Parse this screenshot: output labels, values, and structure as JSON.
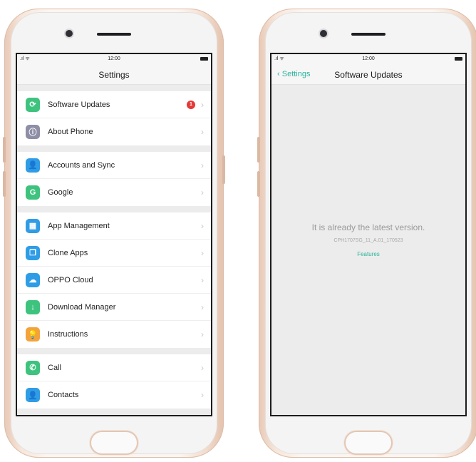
{
  "status_bar": {
    "signal": ".ıl ᯤ",
    "time": "12:00"
  },
  "left_screen": {
    "title": "Settings",
    "groups": [
      {
        "items": [
          {
            "label": "Software Updates",
            "icon": "refresh-icon",
            "glyph": "⟳",
            "color": "#3ec37f",
            "badge": "1"
          },
          {
            "label": "About Phone",
            "icon": "info-icon",
            "glyph": "ⓘ",
            "color": "#8e8ea6"
          }
        ]
      },
      {
        "items": [
          {
            "label": "Accounts and Sync",
            "icon": "person-icon",
            "glyph": "👤",
            "color": "#2f9ce6"
          },
          {
            "label": "Google",
            "icon": "google-icon",
            "glyph": "G",
            "color": "#3ec37f"
          }
        ]
      },
      {
        "items": [
          {
            "label": "App Management",
            "icon": "grid-icon",
            "glyph": "▦",
            "color": "#2f9ce6"
          },
          {
            "label": "Clone Apps",
            "icon": "clone-icon",
            "glyph": "❐",
            "color": "#2f9ce6"
          },
          {
            "label": "OPPO Cloud",
            "icon": "cloud-icon",
            "glyph": "☁",
            "color": "#2f9ce6"
          },
          {
            "label": "Download Manager",
            "icon": "download-icon",
            "glyph": "↓",
            "color": "#3ec37f"
          },
          {
            "label": "Instructions",
            "icon": "bulb-icon",
            "glyph": "💡",
            "color": "#f3a33a"
          }
        ]
      },
      {
        "items": [
          {
            "label": "Call",
            "icon": "phone-icon",
            "glyph": "✆",
            "color": "#3ec37f"
          },
          {
            "label": "Contacts",
            "icon": "contact-icon",
            "glyph": "👤",
            "color": "#2f9ce6"
          }
        ]
      }
    ],
    "chevron": "›"
  },
  "right_screen": {
    "back_label": "Settings",
    "title": "Software Updates",
    "message": "It is already the latest version.",
    "version": "CPH1707SG_11_A.01_170523",
    "features_link": "Features"
  },
  "colors": {
    "accent": "#2bb49a",
    "badge": "#e53935"
  }
}
